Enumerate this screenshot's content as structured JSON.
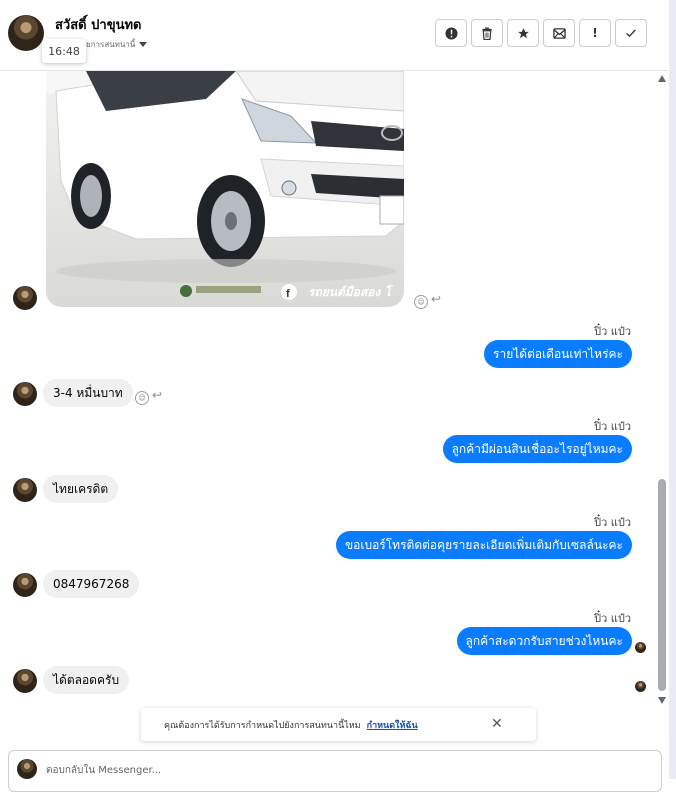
{
  "header": {
    "contact_name": "สวัสดิ์ ปาขุนทด",
    "subtitle": "ยการสนทนานี้",
    "time_tooltip": "16:48"
  },
  "toolbar": [
    {
      "icon": "alert-circle-icon",
      "glyph": "❗"
    },
    {
      "icon": "trash-icon",
      "glyph": "🗑"
    },
    {
      "icon": "star-icon",
      "glyph": "★"
    },
    {
      "icon": "mark-unread-icon",
      "glyph": "✉"
    },
    {
      "icon": "exclamation-icon",
      "glyph": "!"
    },
    {
      "icon": "check-icon",
      "glyph": "✓"
    }
  ],
  "image_message": {
    "watermark_text": "รถยนต์มือสอง โ"
  },
  "messages": [
    {
      "side": "out",
      "sender": "ปิ๋ว แป๋ว",
      "text": "รายได้ต่อเดือนเท่าไหร่คะ"
    },
    {
      "side": "in",
      "text": "3-4 หมื่นบาท"
    },
    {
      "side": "out",
      "sender": "ปิ๋ว แป๋ว",
      "text": "ลูกค้ามีผ่อนสินเชื่ออะไรอยู่ไหมคะ"
    },
    {
      "side": "in",
      "text": "ไทยเครดิต"
    },
    {
      "side": "out",
      "sender": "ปิ๋ว แป๋ว",
      "text": "ขอเบอร์โทรติดต่อคุยรายละเอียดเพิ่มเติมกับเซลล์นะคะ"
    },
    {
      "side": "in",
      "text": "0847967268"
    },
    {
      "side": "out",
      "sender": "ปิ๋ว แป๋ว",
      "text": "ลูกค้าสะดวกรับสายช่วงไหนคะ"
    },
    {
      "side": "in",
      "text": "ได้ตลอดครับ"
    }
  ],
  "banner": {
    "text": "คุณต้องการได้รับการกำหนดไปยังการสนทนานี้ไหม",
    "link": "กำหนดให้ฉัน",
    "close": "✕"
  },
  "composer": {
    "placeholder": "ตอบกลับใน Messenger..."
  },
  "colors": {
    "outgoing_bubble": "#0a7cff",
    "incoming_bubble": "#f0f0f0"
  }
}
